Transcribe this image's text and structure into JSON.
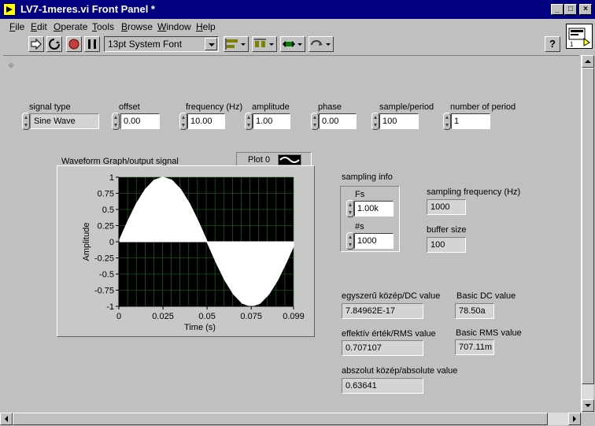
{
  "window": {
    "title": "LV7-1meres.vi Front Panel *"
  },
  "window_controls": {
    "minimize": "_",
    "maximize": "□",
    "close": "×"
  },
  "menu": {
    "items": [
      {
        "label": "File",
        "u": "F",
        "rest": "ile"
      },
      {
        "label": "Edit",
        "u": "E",
        "rest": "dit"
      },
      {
        "label": "Operate",
        "u": "O",
        "rest": "perate"
      },
      {
        "label": "Tools",
        "u": "T",
        "rest": "ools"
      },
      {
        "label": "Browse",
        "u": "B",
        "rest": "rowse"
      },
      {
        "label": "Window",
        "u": "W",
        "rest": "indow"
      },
      {
        "label": "Help",
        "u": "H",
        "rest": "elp"
      }
    ]
  },
  "toolbar": {
    "font": "13pt System Font",
    "help": "?",
    "buttons": [
      "run-icon",
      "run-continuous-icon",
      "abort-icon",
      "pause-icon"
    ],
    "dropdowns": [
      "align-objects-icon",
      "distribute-objects-icon",
      "resize-objects-icon",
      "reorder-icon"
    ]
  },
  "controls": {
    "signal_type": {
      "label": "signal type",
      "value": "Sine Wave"
    },
    "offset": {
      "label": "offset",
      "value": "0.00"
    },
    "frequency": {
      "label": "frequency (Hz)",
      "value": "10.00"
    },
    "amplitude": {
      "label": "amplitude",
      "value": "1.00"
    },
    "phase": {
      "label": "phase",
      "value": "0.00"
    },
    "sample_period": {
      "label": "sample/period",
      "value": "100"
    },
    "number_of_period": {
      "label": "number of period",
      "value": "1"
    }
  },
  "graph": {
    "label": "Waveform Graph/output signal",
    "legend": "Plot 0",
    "colors": {
      "plot_bg": "#000000",
      "grid": "#1e7a1e",
      "trace": "#ffffff"
    }
  },
  "sampling": {
    "cluster_label": "sampling info",
    "fs_label": "Fs",
    "fs_value": "1.00k",
    "ns_label": "#s",
    "ns_value": "1000",
    "sampling_frequency_label": "sampling frequency  (Hz)",
    "sampling_frequency_value": "1000",
    "buffer_size_label": "buffer size",
    "buffer_size_value": "100"
  },
  "results": {
    "dc_label": "egyszerű közép/DC value",
    "dc_value": "7.84962E-17",
    "basic_dc_label": "Basic DC value",
    "basic_dc_value": "78.50a",
    "rms_label": "effektív érték/RMS value",
    "rms_value": "0.707107",
    "basic_rms_label": "Basic RMS value",
    "basic_rms_value": "707.11m",
    "abs_label": "abszolut közép/absolute value",
    "abs_value": "0.63641"
  },
  "chart_data": {
    "type": "area",
    "title": "Waveform Graph/output signal",
    "xlabel": "Time (s)",
    "ylabel": "Amplitude",
    "xlim": [
      0,
      0.099
    ],
    "ylim": [
      -1,
      1
    ],
    "x_ticks": [
      "0",
      "0.025",
      "0.05",
      "0.075",
      "0.099"
    ],
    "y_ticks": [
      "1",
      "0.75",
      "0.5",
      "0.25",
      "0",
      "-0.25",
      "-0.5",
      "-0.75",
      "-1"
    ],
    "grid": true,
    "series": [
      {
        "name": "Plot 0",
        "x": [
          0,
          0.005,
          0.01,
          0.015,
          0.02,
          0.025,
          0.03,
          0.035,
          0.04,
          0.045,
          0.05,
          0.055,
          0.06,
          0.065,
          0.07,
          0.075,
          0.08,
          0.085,
          0.09,
          0.095,
          0.099
        ],
        "y": [
          0,
          0.309,
          0.588,
          0.809,
          0.951,
          1,
          0.951,
          0.809,
          0.588,
          0.309,
          0,
          -0.309,
          -0.588,
          -0.809,
          -0.951,
          -1,
          -0.951,
          -0.809,
          -0.588,
          -0.309,
          -0.063
        ]
      }
    ]
  }
}
